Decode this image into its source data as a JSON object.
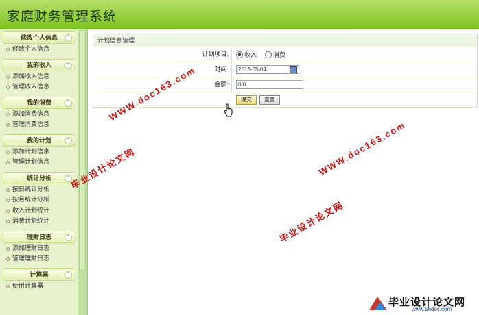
{
  "app": {
    "title": "家庭财务管理系统"
  },
  "sidebar": {
    "sections": [
      {
        "title": "修改个人信息",
        "items": [
          "修改个人信息"
        ]
      },
      {
        "title": "我的收入",
        "items": [
          "添加收入信息",
          "管理收入信息"
        ]
      },
      {
        "title": "我的消费",
        "items": [
          "添加消费信息",
          "管理消费信息"
        ]
      },
      {
        "title": "我的计划",
        "items": [
          "添加计划信息",
          "管理计划信息"
        ]
      },
      {
        "title": "统计分析",
        "items": [
          "按日统计分析",
          "按月统计分析",
          "收入计划统计",
          "消费计划统计"
        ]
      },
      {
        "title": "理财日志",
        "items": [
          "添加理财日志",
          "管理理财日志"
        ]
      },
      {
        "title": "计算器",
        "items": [
          "使用计算器"
        ]
      }
    ]
  },
  "panel": {
    "title": "计划信息管理",
    "plan_label": "计划项目:",
    "option_income": "收入",
    "option_expense": "消费",
    "time_label": "时间:",
    "time_value": "2015-05-04",
    "amount_label": "金额:",
    "amount_value": "0.0",
    "submit_label": "提交",
    "reset_label": "重置"
  },
  "watermarks": {
    "url": "WWW.doc163.com",
    "site_name": "毕业设计论文网"
  },
  "logo": {
    "name": "毕业设计论文网",
    "url": "www.56doc.com"
  }
}
